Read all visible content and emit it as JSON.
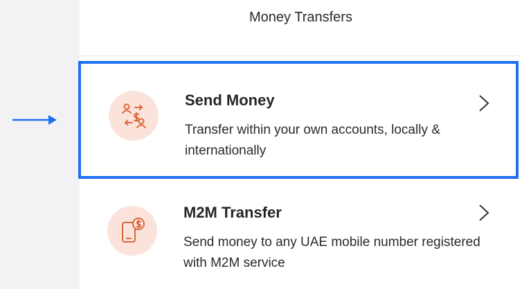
{
  "header": {
    "title": "Money Transfers"
  },
  "items": [
    {
      "title": "Send Money",
      "description": "Transfer within your own accounts, locally & internationally",
      "icon": "transfer-people-icon"
    },
    {
      "title": "M2M Transfer",
      "description": "Send money to any UAE mobile number registered with M2M service",
      "icon": "mobile-money-icon"
    }
  ],
  "colors": {
    "highlight_border": "#1f6ff2",
    "icon_background": "#fbe3dc",
    "icon_stroke": "#d9683a",
    "pointer_arrow": "#1f6ff2"
  }
}
